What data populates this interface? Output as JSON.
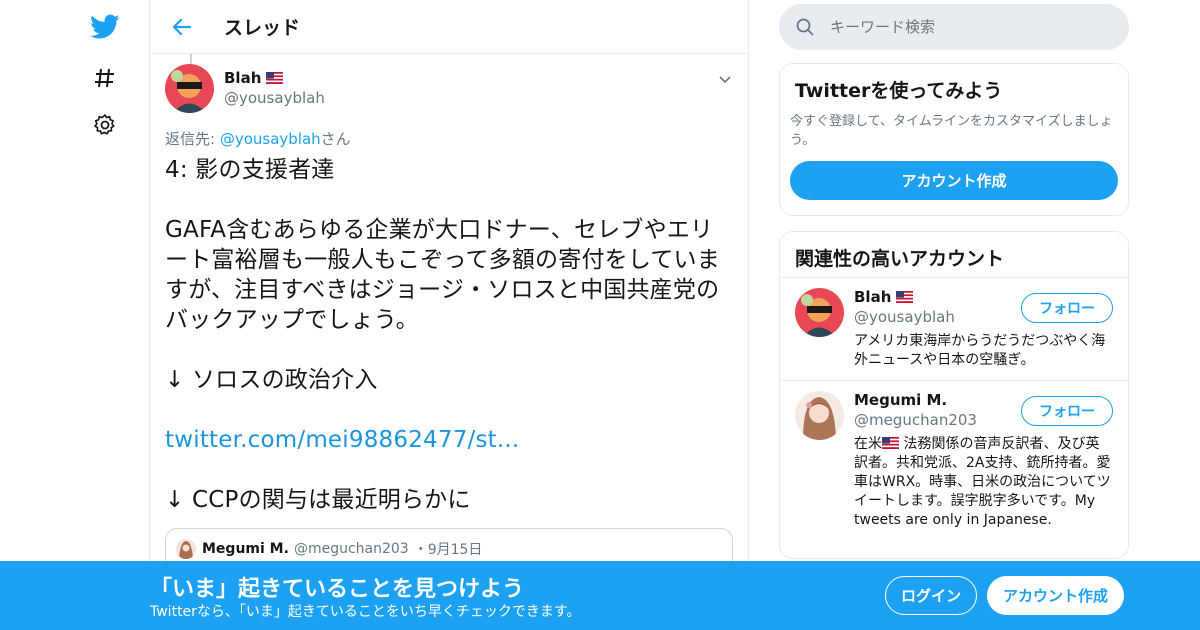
{
  "colors": {
    "accent": "#1da1f2",
    "link": "#1b95e0",
    "muted": "#657786",
    "border": "#e6ecf0"
  },
  "nav": {
    "icons": [
      "twitter-bird-icon",
      "hashtag-icon",
      "gear-icon"
    ]
  },
  "header": {
    "title": "スレッド"
  },
  "tweet": {
    "author_name": "Blah",
    "author_handle": "@yousayblah",
    "reply_prefix": "返信先: ",
    "reply_handle": "@yousayblah",
    "reply_suffix": "さん",
    "text_1": "4: 影の支援者達\n\nGAFA含むあらゆる企業が大口ドナー、セレブやエリート富裕層も一般人もこぞって多額の寄付をしていますが、注目すべきはジョージ・ソロスと中国共産党のバックアップでしょう。\n\n↓ ソロスの政治介入\n\n",
    "link_text": "twitter.com/mei98862477/st...",
    "text_2": "\n\n↓ CCPの関与は最近明らかに",
    "quote": {
      "name": "Megumi M.",
      "handle": "@meguchan203",
      "date": "・9月15日"
    }
  },
  "search": {
    "placeholder": "キーワード検索"
  },
  "signup_card": {
    "title": "Twitterを使ってみよう",
    "text": "今すぐ登録して、タイムラインをカスタマイズしましょう。",
    "button": "アカウント作成"
  },
  "related": {
    "title": "関連性の高いアカウント",
    "accounts": [
      {
        "name": "Blah",
        "handle": "@yousayblah",
        "bio": "アメリカ東海岸からうだうだつぶやく海外ニュースや日本の空騒ぎ。",
        "follow": "フォロー"
      },
      {
        "name": "Megumi M.",
        "handle": "@meguchan203",
        "bio_flag_prefix": "在米",
        "bio": " 法務関係の音声反訳者、及び英訳者。共和党派、2A支持、銃所持者。愛車はWRX。時事、日米の政治についてツイートします。誤字脱字多いです。My tweets are only in Japanese.",
        "follow": "フォロー"
      }
    ]
  },
  "bottom_bar": {
    "title": "「いま」起きていることを見つけよう",
    "subtitle": "Twitterなら、「いま」起きていることをいち早くチェックできます。",
    "login": "ログイン",
    "signup": "アカウント作成"
  }
}
